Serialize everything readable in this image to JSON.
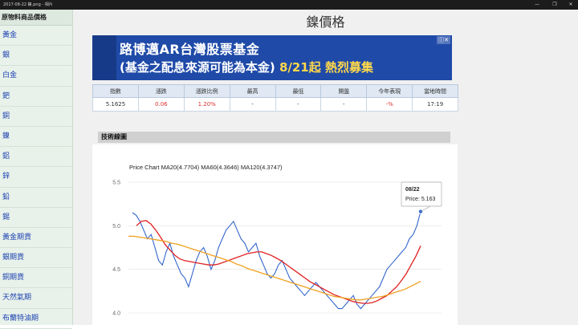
{
  "window": {
    "title": "2017-08-22 鎳.png - 相片",
    "controls": [
      "—",
      "❐",
      "✕"
    ]
  },
  "sidebar": {
    "header": "原物料商品價格",
    "items": [
      "黃金",
      "銀",
      "白金",
      "鈀",
      "銅",
      "鎳",
      "鋁",
      "鋅",
      "鉛",
      "錫",
      "黃金期貨",
      "銀期貨",
      "銅期貨",
      "天然氣期",
      "布蘭特油期"
    ]
  },
  "page": {
    "title": "鎳價格"
  },
  "banner": {
    "line1": "路博邁AR台灣股票基金",
    "line2_a": "(基金之配息來源可能為本金)",
    "line2_b": "8/21起 熱烈募集",
    "ad_mark": "ⓘ✕"
  },
  "quote_table": {
    "headers": [
      "指數",
      "漲跌",
      "漲跌比例",
      "最高",
      "最低",
      "開盤",
      "今年表現",
      "當地時間"
    ],
    "values": [
      "5.1625",
      "0.06",
      "1.20%",
      "-",
      "-",
      "-",
      "-%",
      "17:19"
    ]
  },
  "section": {
    "title": "技術線圖"
  },
  "chart": {
    "title": "Price Chart MA20(4.7704) MA60(4.3646) MA120(4.3747)",
    "y_ticks": [
      "5.5",
      "5.0",
      "4.5",
      "4.0"
    ],
    "tooltip": {
      "date": "08/22",
      "label": "Price:",
      "value": "5.163"
    }
  },
  "chart_data": {
    "type": "line",
    "title": "Price Chart MA20(4.7704) MA60(4.3646) MA120(4.3747)",
    "ylim": [
      4.0,
      5.5
    ],
    "grid": true,
    "series": [
      {
        "name": "Price",
        "color": "#3366cc",
        "values": [
          5.15,
          5.12,
          5.05,
          4.95,
          4.85,
          4.9,
          4.75,
          4.6,
          4.55,
          4.7,
          4.8,
          4.65,
          4.55,
          4.45,
          4.4,
          4.3,
          4.45,
          4.6,
          4.7,
          4.75,
          4.65,
          4.5,
          4.6,
          4.75,
          4.85,
          4.95,
          5.0,
          5.05,
          4.95,
          4.85,
          4.8,
          4.7,
          4.75,
          4.8,
          4.65,
          4.55,
          4.45,
          4.4,
          4.45,
          4.55,
          4.6,
          4.5,
          4.4,
          4.35,
          4.3,
          4.25,
          4.2,
          4.25,
          4.3,
          4.35,
          4.3,
          4.25,
          4.2,
          4.15,
          4.1,
          4.05,
          4.05,
          4.1,
          4.15,
          4.2,
          4.1,
          4.05,
          4.1,
          4.15,
          4.2,
          4.25,
          4.3,
          4.4,
          4.5,
          4.55,
          4.6,
          4.65,
          4.7,
          4.75,
          4.85,
          4.9,
          5.0,
          5.163
        ]
      },
      {
        "name": "MA20",
        "color": "#e02020",
        "values": [
          5.0,
          5.05,
          5.06,
          5.02,
          4.95,
          4.87,
          4.78,
          4.72,
          4.66,
          4.62,
          4.6,
          4.59,
          4.58,
          4.57,
          4.56,
          4.55,
          4.55,
          4.56,
          4.58,
          4.6,
          4.62,
          4.64,
          4.66,
          4.68,
          4.69,
          4.7,
          4.7,
          4.68,
          4.66,
          4.63,
          4.6,
          4.56,
          4.52,
          4.48,
          4.44,
          4.4,
          4.36,
          4.33,
          4.3,
          4.27,
          4.24,
          4.21,
          4.19,
          4.17,
          4.15,
          4.13,
          4.12,
          4.11,
          4.11,
          4.12,
          4.14,
          4.17,
          4.2,
          4.25,
          4.3,
          4.37,
          4.45,
          4.55,
          4.65,
          4.7704
        ]
      },
      {
        "name": "MA60",
        "color": "#f0a020",
        "values": [
          4.88,
          4.88,
          4.87,
          4.86,
          4.85,
          4.84,
          4.83,
          4.82,
          4.8,
          4.79,
          4.77,
          4.75,
          4.73,
          4.71,
          4.69,
          4.67,
          4.65,
          4.63,
          4.61,
          4.59,
          4.56,
          4.54,
          4.51,
          4.49,
          4.47,
          4.45,
          4.43,
          4.41,
          4.39,
          4.37,
          4.35,
          4.33,
          4.31,
          4.29,
          4.27,
          4.25,
          4.23,
          4.21,
          4.19,
          4.18,
          4.17,
          4.16,
          4.15,
          4.15,
          4.16,
          4.17,
          4.18,
          4.19,
          4.21,
          4.23,
          4.25,
          4.27,
          4.3,
          4.33,
          4.3646
        ]
      }
    ]
  }
}
